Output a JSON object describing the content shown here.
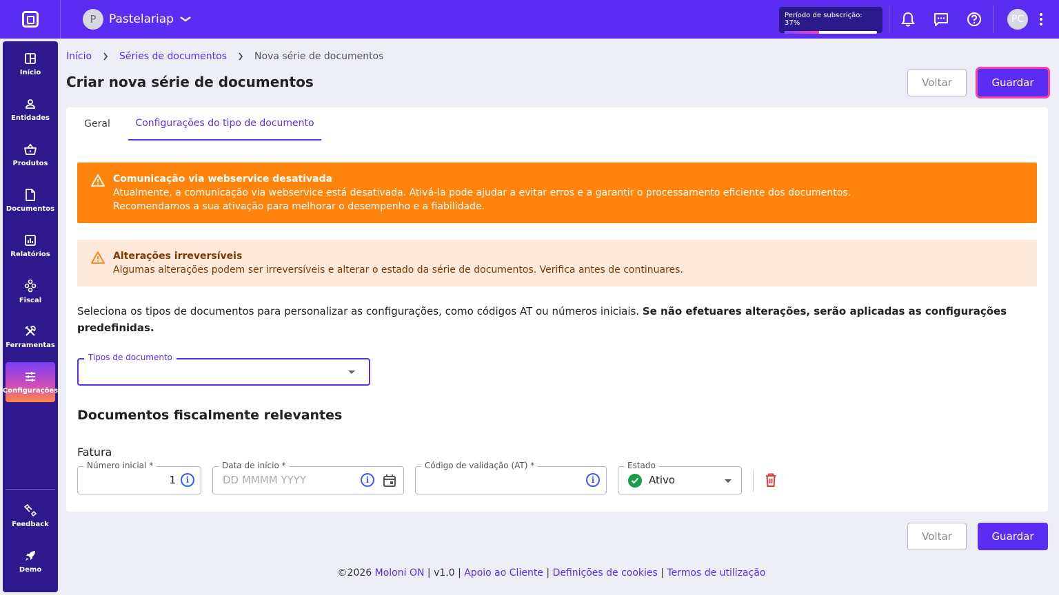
{
  "topbar": {
    "company_initial": "P",
    "company_name": "Pastelariap",
    "subscription_label": "Período de subscrição: 37%",
    "subscription_progress": 0.37,
    "user_initials": "PC"
  },
  "sidebar": {
    "items": [
      {
        "label": "Início",
        "icon": "dashboard-icon"
      },
      {
        "label": "Entidades",
        "icon": "user-icon"
      },
      {
        "label": "Produtos",
        "icon": "basket-icon"
      },
      {
        "label": "Documentos",
        "icon": "document-icon"
      },
      {
        "label": "Relatórios",
        "icon": "chart-icon"
      },
      {
        "label": "Fiscal",
        "icon": "fiscal-icon"
      },
      {
        "label": "Ferramentas",
        "icon": "tools-icon"
      },
      {
        "label": "Configurações",
        "icon": "settings-sliders-icon"
      },
      {
        "label": "Feedback",
        "icon": "feedback-icon"
      },
      {
        "label": "Demo",
        "icon": "rocket-icon"
      }
    ]
  },
  "breadcrumb": {
    "home": "Início",
    "series": "Séries de documentos",
    "current": "Nova série de documentos"
  },
  "page": {
    "title": "Criar nova série de documentos",
    "back_label": "Voltar",
    "save_label": "Guardar"
  },
  "tabs": {
    "general": "Geral",
    "doc_type_config": "Configurações do tipo de documento"
  },
  "alerts": {
    "webservice": {
      "title": "Comunicação via webservice desativada",
      "line1": "Atualmente, a comunicação via webservice está desativada. Ativá-la pode ajudar a evitar erros e a garantir o processamento eficiente dos documentos.",
      "line2": "Recomendamos a sua ativação para melhorar o desempenho e a fiabilidade."
    },
    "irreversible": {
      "title": "Alterações irreversíveis",
      "text": "Algumas alterações podem ser irreversíveis e alterar o estado da série de documentos. Verifica antes de continuares."
    }
  },
  "intro": {
    "text": "Seleciona os tipos de documentos para personalizar as configurações, como códigos AT ou números iniciais. ",
    "bold": "Se não efetuares alterações, serão aplicadas as configurações predefinidas."
  },
  "doc_types_select": {
    "label": "Tipos de documento",
    "value": ""
  },
  "fiscal_section": {
    "title": "Documentos fiscalmente relevantes",
    "doc_name": "Fatura",
    "initial_number_label": "Número inicial *",
    "initial_number_value": "1",
    "start_date_label": "Data de início *",
    "start_date_placeholder": "DD MMMM YYYY",
    "validation_code_label": "Código de validação (AT) *",
    "validation_code_value": "",
    "status_label": "Estado",
    "status_value": "Ativo"
  },
  "footer": {
    "copyright": "©2026",
    "brand": "Moloni ON",
    "version": "v1.0",
    "support": "Apoio ao Cliente",
    "cookies": "Definições de cookies",
    "terms": "Termos de utilização"
  },
  "colors": {
    "brand": "#5b2df2",
    "sidebar": "#2e1a8d",
    "alert_orange": "#ff840d",
    "alert_peach": "#fde9d9",
    "success": "#1b9d4a",
    "danger": "#e53935"
  }
}
